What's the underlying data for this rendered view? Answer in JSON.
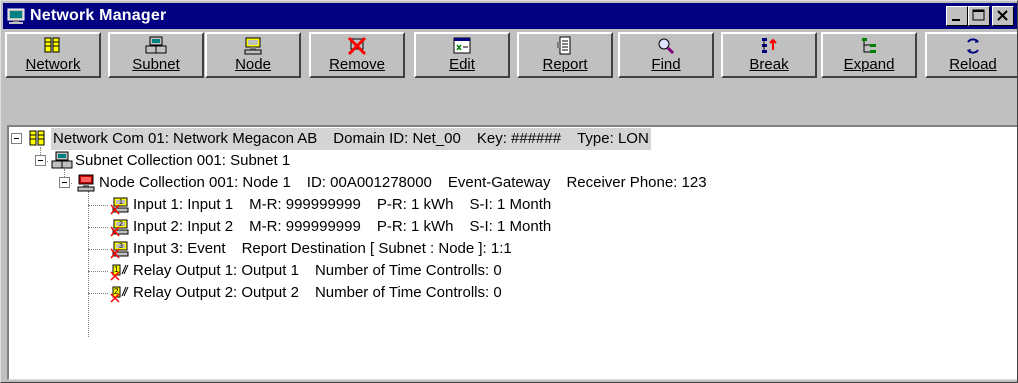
{
  "window": {
    "title": "Network Manager",
    "minimize_label": "_",
    "maximize_label": "□",
    "close_label": "✕"
  },
  "toolbar": {
    "buttons": [
      {
        "label": "Network",
        "icon": "network-icon"
      },
      {
        "label": "Subnet",
        "icon": "subnet-icon"
      },
      {
        "label": "Node",
        "icon": "node-icon"
      },
      {
        "label": "Remove",
        "icon": "remove-icon"
      },
      {
        "label": "Edit",
        "icon": "edit-icon"
      },
      {
        "label": "Report",
        "icon": "report-icon"
      },
      {
        "label": "Find",
        "icon": "find-icon"
      },
      {
        "label": "Break",
        "icon": "break-icon"
      },
      {
        "label": "Expand",
        "icon": "expand-icon"
      },
      {
        "label": "Reload",
        "icon": "reload-icon"
      }
    ]
  },
  "tree": {
    "network": {
      "name": "Network Com 01: Network Megacon AB",
      "domain": "Domain ID: Net_00",
      "key": "Key: ######",
      "type": "Type: LON"
    },
    "subnet": {
      "name": "Subnet Collection 001: Subnet 1"
    },
    "node": {
      "name": "Node Collection 001: Node 1",
      "id": "ID: 00A001278000",
      "mode": "Event-Gateway",
      "receiver": "Receiver Phone: 123"
    },
    "children": [
      {
        "name": "Input 1: Input 1",
        "f1": "M-R: 999999999",
        "f2": "P-R: 1 kWh",
        "f3": "S-I: 1 Month"
      },
      {
        "name": "Input 2: Input 2",
        "f1": "M-R: 999999999",
        "f2": "P-R: 1 kWh",
        "f3": "S-I: 1 Month"
      },
      {
        "name": "Input 3: Event",
        "f1": "Report Destination [ Subnet : Node ]: 1:1",
        "f2": "",
        "f3": ""
      },
      {
        "name": "Relay Output 1: Output 1",
        "f1": "Number of Time Controlls: 0",
        "f2": "",
        "f3": ""
      },
      {
        "name": "Relay Output 2: Output 2",
        "f1": "Number of Time Controlls: 0",
        "f2": "",
        "f3": ""
      }
    ]
  },
  "colors": {
    "titlebar": "#000080",
    "face": "#c0c0c0",
    "selection": "#d4d4d4"
  }
}
